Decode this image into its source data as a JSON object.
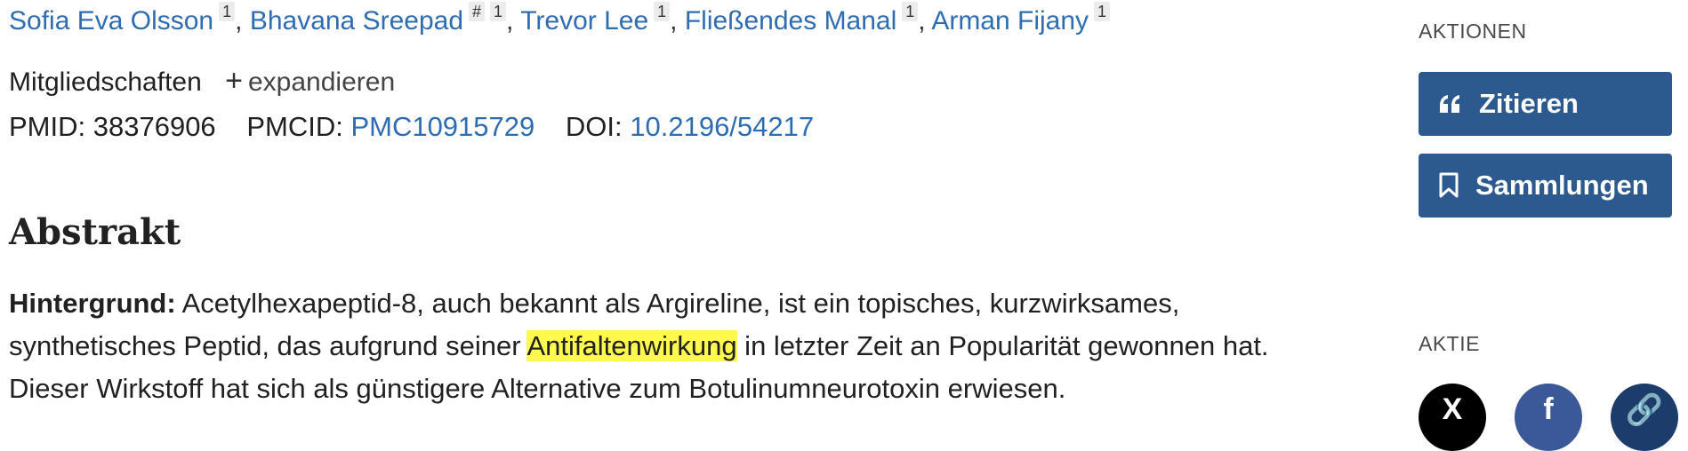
{
  "authors": [
    {
      "name": "Sofia Eva Olsson",
      "aff": "1"
    },
    {
      "name": "Bhavana Sreepad",
      "mark": "#",
      "aff": "1"
    },
    {
      "name": "Trevor Lee",
      "aff": "1"
    },
    {
      "name": "Fließendes Manal",
      "aff": "1"
    },
    {
      "name": "Arman Fijany",
      "aff": "1"
    }
  ],
  "affiliations": {
    "label": "Mitgliedschaften",
    "expand_label": "expandieren"
  },
  "ids": {
    "pmid_label": "PMID:",
    "pmid": "38376906",
    "pmcid_label": "PMCID:",
    "pmcid": "PMC10915729",
    "doi_label": "DOI:",
    "doi": "10.2196/54217"
  },
  "abstract": {
    "title": "Abstrakt",
    "lead": "Hintergrund:",
    "text_before": " Acetylhexapeptid-8, auch bekannt als Argireline, ist ein topisches, kurzwirksames, synthetisches Peptid, das aufgrund seiner ",
    "highlight": "Antifaltenwirkung",
    "text_after": " in letzter Zeit an Popularität gewonnen hat. Dieser Wirkstoff hat sich als günstigere Alternative zum Botulinumneurotoxin erwiesen."
  },
  "sidebar": {
    "actions_label": "AKTIONEN",
    "cite_label": "Zitieren",
    "collections_label": "Sammlungen",
    "share_label": "AKTIE",
    "share_icons": [
      "x-logo-icon",
      "facebook-icon",
      "link-icon"
    ]
  },
  "colors": {
    "link": "#2f6db3",
    "button": "#2c5a8f",
    "highlight": "#fff94d",
    "x": "#000000",
    "facebook": "#3b5998",
    "copy_link": "#1c3c6b"
  }
}
